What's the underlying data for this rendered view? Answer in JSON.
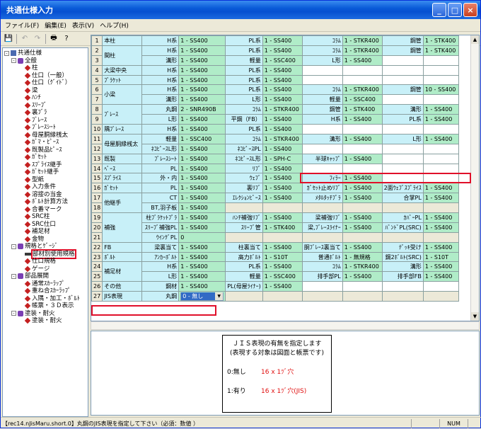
{
  "window": {
    "title": "共通仕様入力",
    "btn_min": "_",
    "btn_max": "□",
    "btn_close": "×"
  },
  "menu": [
    "ファイル(F)",
    "編集(E)",
    "表示(V)",
    "ヘルプ(H)"
  ],
  "toolbar": {
    "save": "💾",
    "undo": "↶",
    "redo": "↷",
    "print": "🖶",
    "help": "?"
  },
  "tree": [
    {
      "t": "共通仕様",
      "lvl": 0,
      "icon": "root",
      "exp": "-"
    },
    {
      "t": "全般",
      "lvl": 1,
      "icon": "folder",
      "exp": "-"
    },
    {
      "t": "柱",
      "lvl": 2,
      "icon": "leaf"
    },
    {
      "t": "仕口（一般）",
      "lvl": 2,
      "icon": "leaf"
    },
    {
      "t": "仕口（ｸﾞｲﾄﾞ）",
      "lvl": 2,
      "icon": "leaf"
    },
    {
      "t": "梁",
      "lvl": 2,
      "icon": "leaf"
    },
    {
      "t": "ﾊﾝﾁ",
      "lvl": 2,
      "icon": "leaf"
    },
    {
      "t": "ｽﾘｰﾌﾞ",
      "lvl": 2,
      "icon": "leaf"
    },
    {
      "t": "裏ﾌﾞﾗ",
      "lvl": 2,
      "icon": "leaf"
    },
    {
      "t": "ﾌﾞﾚｰｽ",
      "lvl": 2,
      "icon": "leaf"
    },
    {
      "t": "ﾌﾞﾚｰｽｼｰﾄ",
      "lvl": 2,
      "icon": "leaf"
    },
    {
      "t": "母屋胴縁桟太",
      "lvl": 2,
      "icon": "leaf"
    },
    {
      "t": "ｶﾞﾏ・ﾋﾟｰｽ",
      "lvl": 2,
      "icon": "leaf"
    },
    {
      "t": "既製品ﾋﾟｰｽ",
      "lvl": 2,
      "icon": "leaf"
    },
    {
      "t": "ｶﾞｾｯﾄ",
      "lvl": 2,
      "icon": "leaf"
    },
    {
      "t": "ｽﾌﾟﾗｲｽ継手",
      "lvl": 2,
      "icon": "leaf"
    },
    {
      "t": "ｶﾞｾｯﾄ継手",
      "lvl": 2,
      "icon": "leaf"
    },
    {
      "t": "型紙",
      "lvl": 2,
      "icon": "leaf"
    },
    {
      "t": "入力条件",
      "lvl": 2,
      "icon": "leaf"
    },
    {
      "t": "溶接の当金",
      "lvl": 2,
      "icon": "leaf"
    },
    {
      "t": "ﾎﾞﾙﾄ計算方法",
      "lvl": 2,
      "icon": "leaf"
    },
    {
      "t": "合番マーク",
      "lvl": 2,
      "icon": "leaf"
    },
    {
      "t": "SRC柱",
      "lvl": 2,
      "icon": "leaf"
    },
    {
      "t": "SRC仕口",
      "lvl": 2,
      "icon": "leaf"
    },
    {
      "t": "補足材",
      "lvl": 2,
      "icon": "leaf"
    },
    {
      "t": "金物",
      "lvl": 2,
      "icon": "leaf"
    },
    {
      "t": "規格とｹﾞｰｼﾞ",
      "lvl": 1,
      "icon": "folder",
      "exp": "-"
    },
    {
      "t": "部材別使用規格",
      "lvl": 2,
      "icon": "pencil",
      "sel": true
    },
    {
      "t": "仕口規格",
      "lvl": 2,
      "icon": "leaf"
    },
    {
      "t": "ゲージ",
      "lvl": 2,
      "icon": "leaf"
    },
    {
      "t": "部品展開",
      "lvl": 1,
      "icon": "folder",
      "exp": "-"
    },
    {
      "t": "通常ｽｶｰﾗｯﾌﾟ",
      "lvl": 2,
      "icon": "leaf"
    },
    {
      "t": "重ね合ｽｶｰﾗｯﾌﾟ",
      "lvl": 2,
      "icon": "leaf"
    },
    {
      "t": "入隅・加工・ﾎﾞﾙﾄ",
      "lvl": 2,
      "icon": "leaf"
    },
    {
      "t": "帳票・３Ｄ表示",
      "lvl": 2,
      "icon": "leaf"
    },
    {
      "t": "塗装・耐火",
      "lvl": 1,
      "icon": "folder",
      "exp": "-"
    },
    {
      "t": "塗装・耐火",
      "lvl": 2,
      "icon": "leaf"
    }
  ],
  "rows": [
    {
      "n": "1",
      "cat": "本柱",
      "c": [
        [
          "H系",
          "1 - SS400"
        ],
        [
          "PL系",
          "1 - SS400"
        ],
        [
          "ｺﾗﾑ",
          "1 - STKR400"
        ],
        [
          "鋼管",
          "1 - STK400"
        ]
      ]
    },
    {
      "n": "2",
      "cat": "間柱",
      "c": [
        [
          "H系",
          "1 - SS400"
        ],
        [
          "PL系",
          "1 - SS400"
        ],
        [
          "ｺﾗﾑ",
          "1 - STKR400"
        ],
        [
          "鋼管",
          "1 - STK400"
        ]
      ]
    },
    {
      "n": "3",
      "cat": "",
      "c": [
        [
          "溝形",
          "1 - SS400"
        ],
        [
          "軽量",
          "1 - SSC400"
        ],
        [
          "L形",
          "1 - SS400"
        ],
        null
      ]
    },
    {
      "n": "4",
      "cat": "大梁中央",
      "c": [
        [
          "H系",
          "1 - SS400"
        ],
        [
          "PL系",
          "1 - SS400"
        ],
        null,
        null
      ]
    },
    {
      "n": "5",
      "cat": "ﾌﾞﾗｹｯﾄ",
      "c": [
        [
          "H系",
          "1 - SS400"
        ],
        [
          "PL系",
          "1 - SS400"
        ],
        null,
        null
      ]
    },
    {
      "n": "6",
      "cat": "小梁",
      "c": [
        [
          "H系",
          "1 - SS400"
        ],
        [
          "PL系",
          "1 - SS400"
        ],
        [
          "ｺﾗﾑ",
          "1 - STKR400"
        ],
        [
          "鋼管",
          "10 - SS400"
        ]
      ]
    },
    {
      "n": "7",
      "cat": "",
      "c": [
        [
          "溝形",
          "1 - SS400"
        ],
        [
          "L形",
          "1 - SS400"
        ],
        [
          "軽量",
          "1 - SSC400"
        ],
        null
      ]
    },
    {
      "n": "8",
      "cat": "ﾌﾞﾚｰｽ",
      "c": [
        [
          "丸鋼",
          "2 - SNR490B"
        ],
        [
          "ｺﾗﾑ",
          "1 - STKR400"
        ],
        [
          "鋼管",
          "1 - STK400"
        ],
        [
          "溝形",
          "1 - SS400"
        ]
      ]
    },
    {
      "n": "9",
      "cat": "",
      "c": [
        [
          "L形",
          "1 - SS400"
        ],
        [
          "平鋼（FB）",
          "1 - SS400"
        ],
        [
          "H系",
          "1 - SS400"
        ],
        [
          "PL系",
          "1 - SS400"
        ]
      ]
    },
    {
      "n": "10",
      "cat": "隅ﾌﾞﾚｰｽ",
      "c": [
        [
          "H系",
          "1 - SS400"
        ],
        [
          "PL系",
          "1 - SS400"
        ],
        null,
        null
      ]
    },
    {
      "n": "11",
      "cat": "母屋胴縁桟太",
      "c": [
        [
          "軽量",
          "1 - SSC400"
        ],
        [
          "ｺﾗﾑ",
          "1 - STKR400"
        ],
        [
          "溝形",
          "1 - SS400"
        ],
        [
          "L形",
          "1 - SS400"
        ]
      ]
    },
    {
      "n": "12",
      "cat": "",
      "c": [
        [
          "ﾈｺﾋﾟｰｽL形",
          "1 - SS400"
        ],
        [
          "ﾈｺﾋﾟｰｽPL",
          "1 - SS400"
        ],
        null,
        null
      ]
    },
    {
      "n": "13",
      "cat": "既製",
      "c": [
        [
          "ﾌﾞﾚｰｽｼｰﾄ",
          "1 - SS400"
        ],
        [
          "ﾈｺﾋﾟｰｽL形",
          "1 - SPH-C"
        ],
        [
          "半球ｷｬｯﾌﾟ",
          "1 - SS400"
        ],
        null
      ]
    },
    {
      "n": "14",
      "cat": "ﾍﾞｰｽ",
      "c": [
        [
          "PL",
          "1 - SS400"
        ],
        [
          "ﾘﾌﾞ",
          "1 - SS400"
        ],
        null,
        null
      ]
    },
    {
      "n": "15",
      "cat": "ｽﾌﾟﾗｲｽ",
      "c": [
        [
          "外・内",
          "1 - SS400"
        ],
        [
          "ｳｪﾌﾞ",
          "1 - SS400"
        ],
        [
          "ﾌｨﾗｰ",
          "1 - SS400"
        ],
        null
      ]
    },
    {
      "n": "16",
      "cat": "ｶﾞｾｯﾄ",
      "c": [
        [
          "PL",
          "1 - SS400"
        ],
        [
          "裏ﾘﾌﾞ",
          "1 - SS400"
        ],
        [
          "ｶﾞｾｯﾄ止めﾘﾌﾞ",
          "1 - SS400"
        ],
        [
          "2面ｳｪﾌﾞｽﾌﾟﾗｲｽ",
          "1 - SS400"
        ]
      ]
    },
    {
      "n": "17",
      "cat": "他継手",
      "c": [
        [
          "CT",
          "1 - SS400"
        ],
        [
          "ｴﾚｸｼｮﾝﾋﾟｰｽ",
          "1 - SS400"
        ],
        [
          "ﾒﾀﾙﾀｯﾁﾌﾟﾗ",
          "1 - SS400"
        ],
        [
          "合掌PL",
          "1 - SS400"
        ]
      ]
    },
    {
      "n": "18",
      "cat": "",
      "c": [
        [
          "BT,羽子板",
          "1 - SS400"
        ],
        null,
        null,
        null
      ]
    },
    {
      "n": "19",
      "cat": "補強",
      "c": [
        [
          "柱ﾌﾞﾗｹｯﾄﾌﾟﾗ",
          "1 - SS400"
        ],
        [
          "ﾊﾝﾁ補強ﾘﾌﾞ",
          "1 - SS400"
        ],
        [
          "梁補強ﾘﾌﾞ",
          "1 - SS400"
        ],
        [
          "ｶﾊﾞｰPL",
          "1 - SS400"
        ]
      ]
    },
    {
      "n": "20",
      "cat": "",
      "c": [
        [
          "ｽﾘｰﾌﾞ補強PL",
          "1 - SS400"
        ],
        [
          "ｽﾘｰﾌﾞ管",
          "1 - STK400"
        ],
        [
          "梁,ﾌﾞﾚｰｽﾗｲﾅｰ",
          "1 - SS400"
        ],
        [
          "ﾊﾞﾝﾄﾞPL(SRC)",
          "1 - SS400"
        ]
      ]
    },
    {
      "n": "21",
      "cat": "",
      "c": [
        [
          "ｳｲﾝｸﾞPL",
          "0"
        ],
        null,
        null,
        null
      ]
    },
    {
      "n": "22",
      "cat": "FB",
      "c": [
        [
          "梁裏当て",
          "1 - SS400"
        ],
        [
          "柱裏当て",
          "1 - SS400"
        ],
        [
          "胴ﾌﾞﾚｰｽ裏当て",
          "1 - SS400"
        ],
        [
          "ﾃﾞｯｷ受け",
          "1 - SS400"
        ]
      ]
    },
    {
      "n": "23",
      "cat": "ﾎﾞﾙﾄ",
      "c": [
        [
          "ｱﾝｶｰﾎﾞﾙﾄ",
          "1 - SS400"
        ],
        [
          "高力ﾎﾞﾙﾄ",
          "1 - S10T"
        ],
        [
          "普通ﾎﾞﾙﾄ",
          "1 - 無規格"
        ],
        [
          "鋼2ﾎﾞﾙﾄ(SRC)",
          "1 - S10T"
        ]
      ]
    },
    {
      "n": "24",
      "cat": "補足材",
      "c": [
        [
          "H系",
          "1 - SS400"
        ],
        [
          "PL系",
          "1 - SS400"
        ],
        [
          "ｺﾗﾑ",
          "1 - STKR400"
        ],
        [
          "溝形",
          "1 - SS400"
        ]
      ]
    },
    {
      "n": "25",
      "cat": "",
      "c": [
        [
          "L形",
          "1 - SS400"
        ],
        [
          "軽量",
          "1 - SSC400"
        ],
        [
          "排手部PL",
          "1 - SS400"
        ],
        [
          "排手部FB",
          "1 - SS400"
        ]
      ]
    },
    {
      "n": "26",
      "cat": "その他",
      "c": [
        [
          "鋼材",
          "1 - SS400"
        ],
        [
          "PL(母屋ﾗｲﾅｰ)",
          "1 - SS400"
        ],
        null,
        null
      ]
    },
    {
      "n": "27",
      "cat": "JIS表現",
      "c": [
        [
          "丸鋼",
          "0 - 無し"
        ],
        null,
        null,
        null
      ]
    }
  ],
  "help": {
    "line1": "ＪＩＳ表現の有無を指定します",
    "line2": "(表現する対象は図面と帳票です)",
    "opt0_key": "0:無し",
    "opt0_val": "16 x 1ﾂﾞ穴",
    "opt1_key": "1:有り",
    "opt1_val": "16 x 1ﾂﾞ穴(JIS)"
  },
  "status": {
    "message": "【rec14.nJisMaru.short.0】丸鋼のJIS表現を指定して下さい（必須：数値 ）",
    "num": "NUM"
  },
  "colors": {
    "highlight": "#e0102a",
    "label_bg": "#c8f0f8",
    "value_bg": "#b0ecc8"
  }
}
